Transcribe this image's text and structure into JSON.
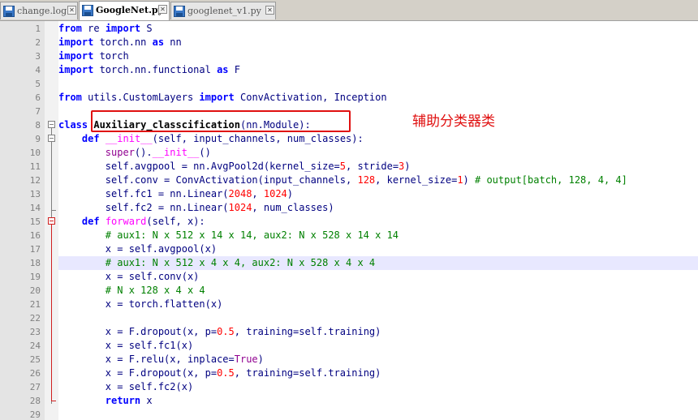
{
  "tabs": [
    {
      "label": "change.log",
      "active": false,
      "icon": "save-icon"
    },
    {
      "label": "GoogleNet.py",
      "active": true,
      "icon": "save-icon"
    },
    {
      "label": "googlenet_v1.py",
      "active": false,
      "icon": "save-icon"
    }
  ],
  "highlighted_line": 18,
  "annotation": {
    "text": "辅助分类器类",
    "color": "#e01010"
  },
  "colors": {
    "keyword": "#0000ff",
    "identifier": "#000080",
    "number": "#ff0000",
    "comment": "#008000",
    "function_name": "#ff00ff",
    "builtin": "#900090",
    "fold_marker": "#d02020"
  },
  "lines": [
    [
      [
        "kw",
        "from"
      ],
      [
        "id",
        " re "
      ],
      [
        "kw",
        "import"
      ],
      [
        "id",
        " S"
      ]
    ],
    [
      [
        "kw",
        "import"
      ],
      [
        "id",
        " torch.nn "
      ],
      [
        "kw",
        "as"
      ],
      [
        "id",
        " nn"
      ]
    ],
    [
      [
        "kw",
        "import"
      ],
      [
        "id",
        " torch"
      ]
    ],
    [
      [
        "kw",
        "import"
      ],
      [
        "id",
        " torch.nn.functional "
      ],
      [
        "kw",
        "as"
      ],
      [
        "id",
        " F"
      ]
    ],
    [],
    [
      [
        "kw",
        "from"
      ],
      [
        "id",
        " utils.CustomLayers "
      ],
      [
        "kw",
        "import"
      ],
      [
        "id",
        " ConvActivation, Inception"
      ]
    ],
    [],
    [
      [
        "kw",
        "class"
      ],
      [
        "id",
        " "
      ],
      [
        "cls",
        "Auxiliary_classcification"
      ],
      [
        "id",
        "(nn.Module):"
      ]
    ],
    [
      [
        "id",
        "    "
      ],
      [
        "kw",
        "def"
      ],
      [
        "id",
        " "
      ],
      [
        "fn",
        "__init__"
      ],
      [
        "id",
        "(self, input_channels, num_classes):"
      ]
    ],
    [
      [
        "id",
        "        "
      ],
      [
        "bi",
        "super"
      ],
      [
        "id",
        "()."
      ],
      [
        "fn",
        "__init__"
      ],
      [
        "id",
        "()"
      ]
    ],
    [
      [
        "id",
        "        self.avgpool = nn.AvgPool2d(kernel_size="
      ],
      [
        "num",
        "5"
      ],
      [
        "id",
        ", stride="
      ],
      [
        "num",
        "3"
      ],
      [
        "id",
        ")"
      ]
    ],
    [
      [
        "id",
        "        self.conv = ConvActivation(input_channels, "
      ],
      [
        "num",
        "128"
      ],
      [
        "id",
        ", kernel_size="
      ],
      [
        "num",
        "1"
      ],
      [
        "id",
        ") "
      ],
      [
        "cm",
        "# output[batch, 128, 4, 4]"
      ]
    ],
    [
      [
        "id",
        "        self.fc1 = nn.Linear("
      ],
      [
        "num",
        "2048"
      ],
      [
        "id",
        ", "
      ],
      [
        "num",
        "1024"
      ],
      [
        "id",
        ")"
      ]
    ],
    [
      [
        "id",
        "        self.fc2 = nn.Linear("
      ],
      [
        "num",
        "1024"
      ],
      [
        "id",
        ", num_classes)"
      ]
    ],
    [
      [
        "id",
        "    "
      ],
      [
        "kw",
        "def"
      ],
      [
        "id",
        " "
      ],
      [
        "fn",
        "forward"
      ],
      [
        "id",
        "(self, x):"
      ]
    ],
    [
      [
        "id",
        "        "
      ],
      [
        "cm",
        "# aux1: N x 512 x 14 x 14, aux2: N x 528 x 14 x 14"
      ]
    ],
    [
      [
        "id",
        "        x = self.avgpool(x)"
      ]
    ],
    [
      [
        "id",
        "        "
      ],
      [
        "cm",
        "# aux1: N x 512 x 4 x 4, aux2: N x 528 x 4 x 4"
      ]
    ],
    [
      [
        "id",
        "        x = self.conv(x)"
      ]
    ],
    [
      [
        "id",
        "        "
      ],
      [
        "cm",
        "# N x 128 x 4 x 4"
      ]
    ],
    [
      [
        "id",
        "        x = torch.flatten(x)"
      ]
    ],
    [],
    [
      [
        "id",
        "        x = F.dropout(x, p="
      ],
      [
        "num",
        "0.5"
      ],
      [
        "id",
        ", training=self.training)"
      ]
    ],
    [
      [
        "id",
        "        x = self.fc1(x)"
      ]
    ],
    [
      [
        "id",
        "        x = F.relu(x, inplace="
      ],
      [
        "bi",
        "True"
      ],
      [
        "id",
        ")"
      ]
    ],
    [
      [
        "id",
        "        x = F.dropout(x, p="
      ],
      [
        "num",
        "0.5"
      ],
      [
        "id",
        ", training=self.training)"
      ]
    ],
    [
      [
        "id",
        "        x = self.fc2(x)"
      ]
    ],
    [
      [
        "id",
        "        "
      ],
      [
        "kw",
        "return"
      ],
      [
        "id",
        " x"
      ]
    ],
    []
  ],
  "line_numbers": [
    "1",
    "2",
    "3",
    "4",
    "5",
    "6",
    "7",
    "8",
    "9",
    "10",
    "11",
    "12",
    "13",
    "14",
    "15",
    "16",
    "17",
    "18",
    "19",
    "20",
    "21",
    "22",
    "23",
    "24",
    "25",
    "26",
    "27",
    "28",
    "29"
  ]
}
